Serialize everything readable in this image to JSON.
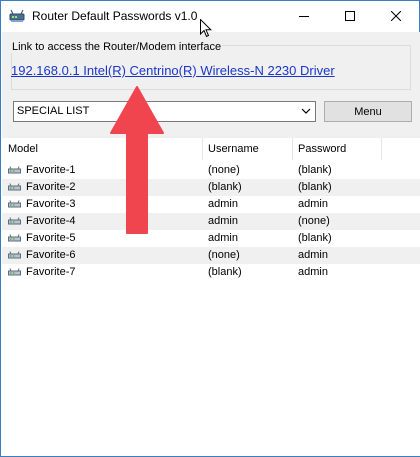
{
  "window": {
    "title": "Router Default Passwords v1.0",
    "controls": {
      "minimize": "minimize",
      "maximize": "maximize",
      "close": "close"
    }
  },
  "groupbox": {
    "label": "Link to access the Router/Modem interface",
    "link": "192.168.0.1   Intel(R) Centrino(R) Wireless-N 2230 Driver"
  },
  "toolbar": {
    "select_value": "SPECIAL LIST",
    "menu_label": "Menu"
  },
  "table": {
    "columns": [
      "Model",
      "Username",
      "Password"
    ],
    "rows": [
      {
        "model": "Favorite-1",
        "username": "(none)",
        "password": "(blank)"
      },
      {
        "model": "Favorite-2",
        "username": "(blank)",
        "password": "(blank)"
      },
      {
        "model": "Favorite-3",
        "username": "admin",
        "password": "admin"
      },
      {
        "model": "Favorite-4",
        "username": "admin",
        "password": "(none)"
      },
      {
        "model": "Favorite-5",
        "username": "admin",
        "password": "(blank)"
      },
      {
        "model": "Favorite-6",
        "username": "(none)",
        "password": "admin"
      },
      {
        "model": "Favorite-7",
        "username": "(blank)",
        "password": "admin"
      }
    ]
  },
  "icons": {
    "app": "router-icon",
    "row": "network-device-icon",
    "dropdown": "chevron-down-icon"
  },
  "colors": {
    "link": "#1a36c9",
    "annotation_arrow": "#f0454f",
    "window_border": "#3b7dc4"
  }
}
